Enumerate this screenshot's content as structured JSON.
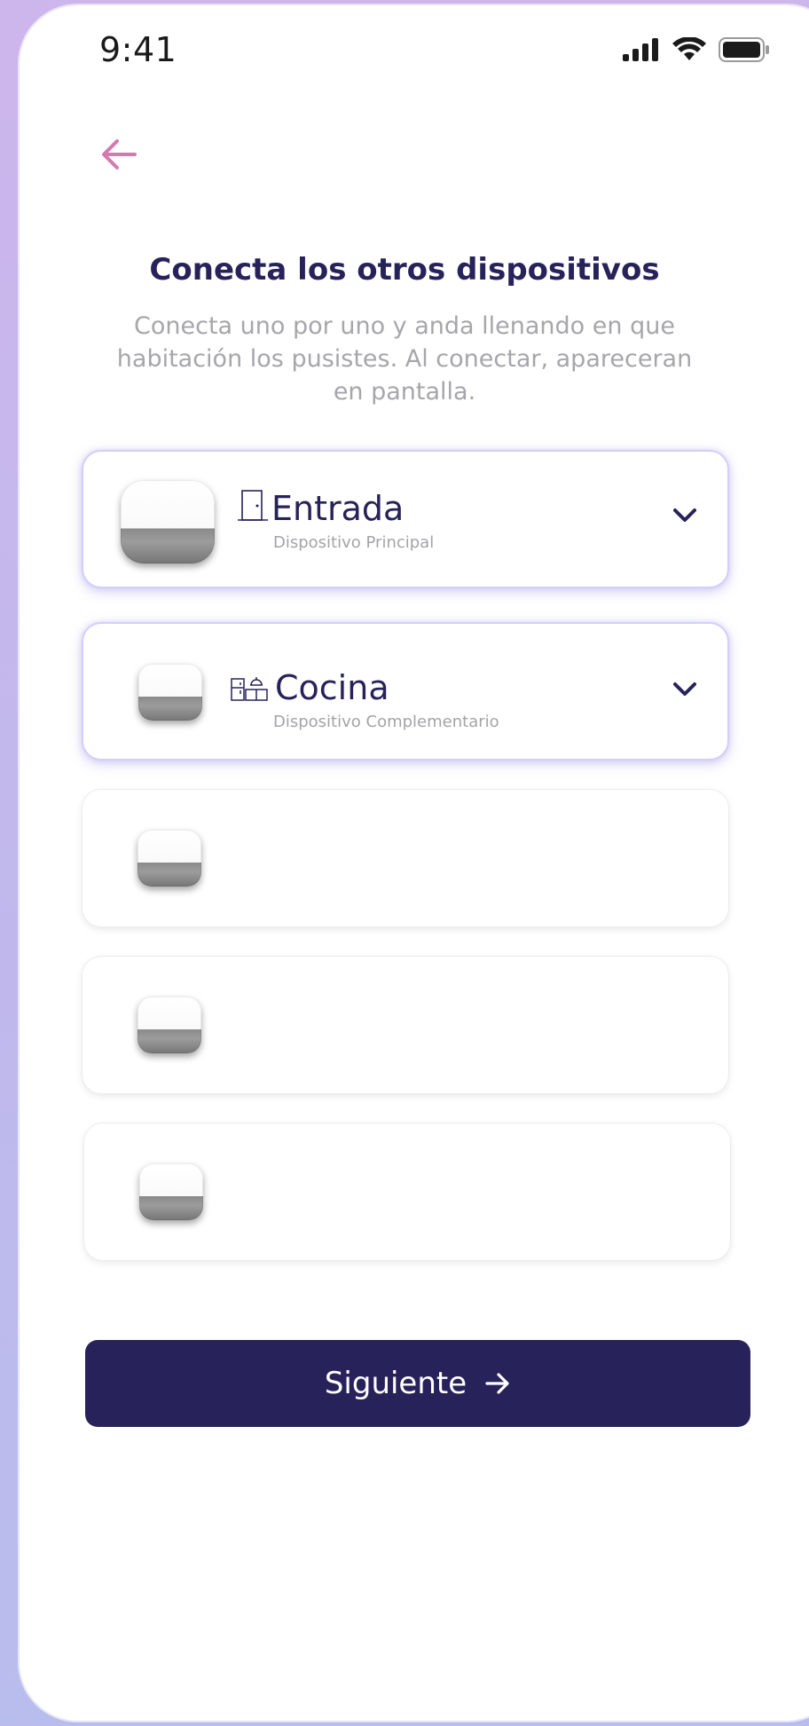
{
  "status_bar": {
    "time": "9:41"
  },
  "header": {
    "title": "Conecta los otros dispositivos",
    "subtitle": "Conecta uno por uno y anda llenando en que habitación los pusistes. Al conectar, apareceran en pantalla."
  },
  "devices": [
    {
      "room": "Entrada",
      "role": "Dispositivo Principal",
      "icon": "door-icon",
      "state": "connected"
    },
    {
      "room": "Cocina",
      "role": "Dispositivo Complementario",
      "icon": "kitchen-icon",
      "state": "connected"
    },
    {
      "room": "",
      "role": "",
      "icon": "",
      "state": "empty"
    },
    {
      "room": "",
      "role": "",
      "icon": "",
      "state": "empty"
    },
    {
      "room": "",
      "role": "",
      "icon": "",
      "state": "empty"
    }
  ],
  "footer": {
    "next_label": "Siguiente"
  },
  "colors": {
    "primary": "#27235a",
    "accent": "#d57aae",
    "muted_text": "#a6a6ab",
    "active_border": "#d4ceff"
  }
}
